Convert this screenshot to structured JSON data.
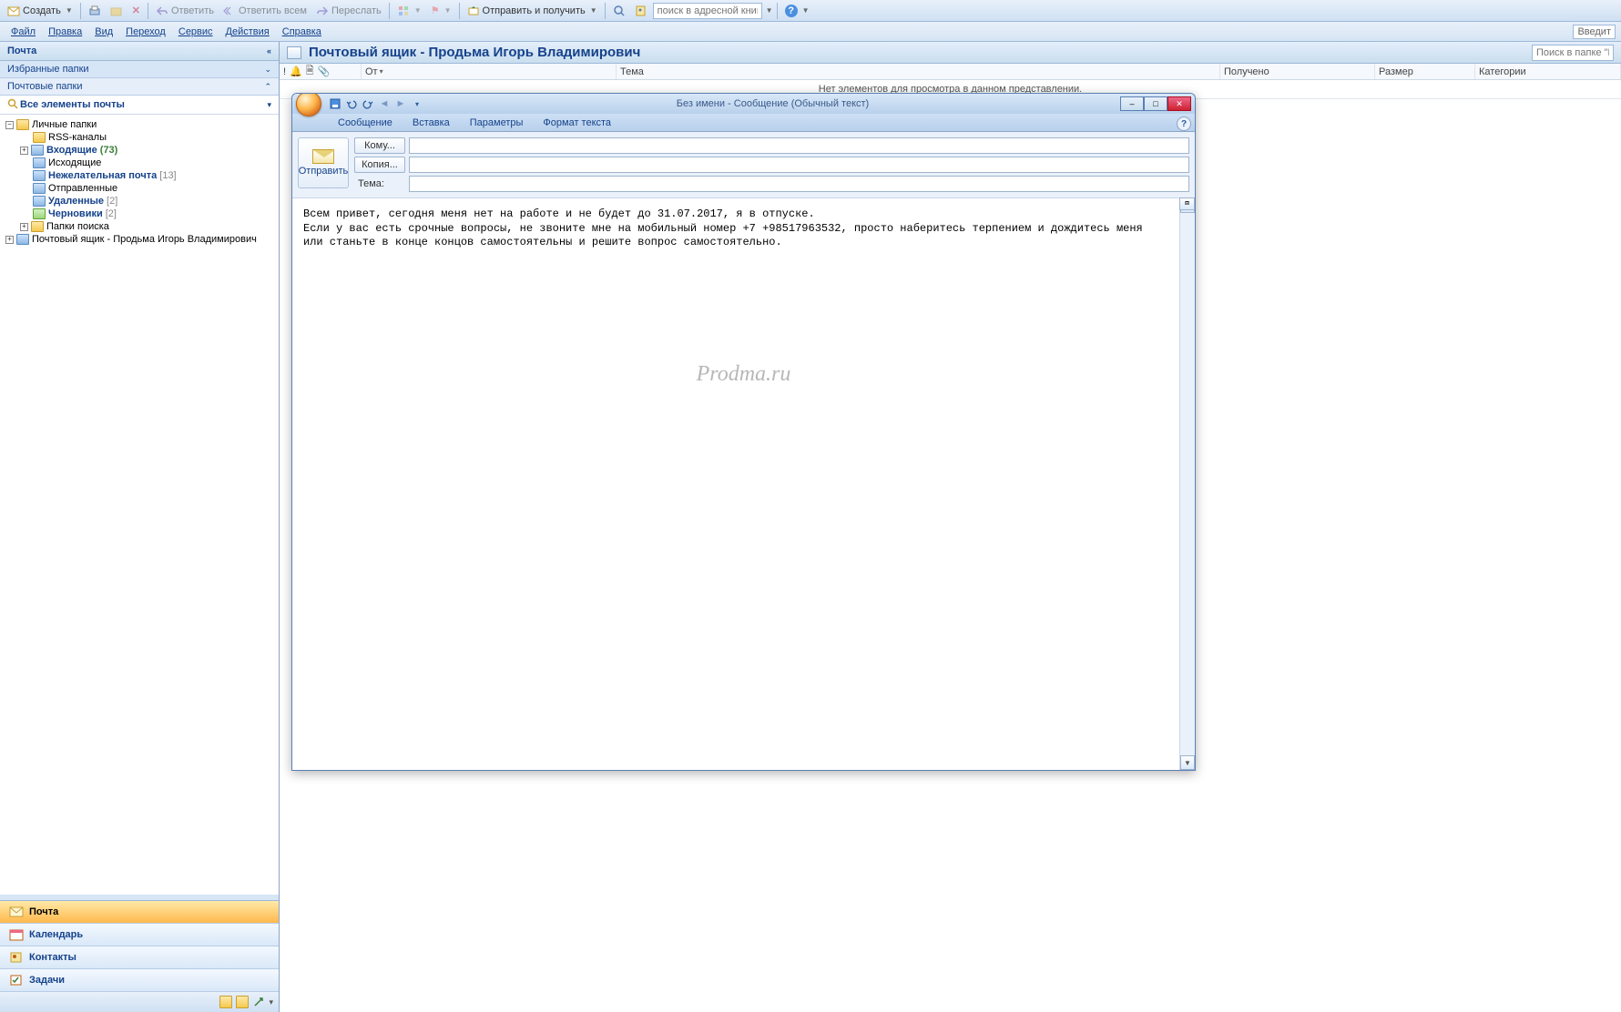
{
  "toolbar": {
    "create": "Создать",
    "reply": "Ответить",
    "reply_all": "Ответить всем",
    "forward": "Переслать",
    "send_receive": "Отправить и получить",
    "addrbook_placeholder": "поиск в адресной книге"
  },
  "menu": {
    "file": "Файл",
    "edit": "Правка",
    "view": "Вид",
    "go": "Переход",
    "tools": "Сервис",
    "actions": "Действия",
    "help": "Справка",
    "type_hint": "Введит"
  },
  "sidebar": {
    "mail_header": "Почта",
    "fav_folders": "Избранные папки",
    "mail_folders": "Почтовые папки",
    "all_items": "Все элементы почты",
    "tree": {
      "personal": "Личные папки",
      "rss": "RSS-каналы",
      "inbox": "Входящие",
      "inbox_count": "(73)",
      "outbox": "Исходящие",
      "junk": "Нежелательная почта",
      "junk_count": "[13]",
      "sent": "Отправленные",
      "deleted": "Удаленные",
      "deleted_count": "[2]",
      "drafts": "Черновики",
      "drafts_count": "[2]",
      "search": "Папки поиска",
      "mailbox2": "Почтовый ящик - Продьма Игорь Владимирович"
    },
    "nav": {
      "mail": "Почта",
      "calendar": "Календарь",
      "contacts": "Контакты",
      "tasks": "Задачи"
    }
  },
  "content": {
    "title": "Почтовый ящик - Продьма Игорь Владимирович",
    "search_placeholder": "Поиск в папке \"Почто",
    "columns": {
      "from": "От",
      "subject": "Тема",
      "received": "Получено",
      "size": "Размер",
      "categories": "Категории"
    },
    "empty": "Нет элементов для просмотра в данном представлении."
  },
  "compose": {
    "title": "Без имени - Сообщение (Обычный текст)",
    "tabs": {
      "message": "Сообщение",
      "insert": "Вставка",
      "options": "Параметры",
      "format": "Формат текста"
    },
    "send": "Отправить",
    "to": "Кому...",
    "cc": "Копия...",
    "subject": "Тема:",
    "body": "Всем привет, сегодня меня нет на работе и не будет до 31.07.2017, я в отпуске.\nЕсли у вас есть срочные вопросы, не звоните мне на мобильный номер +7 +98517963532, просто наберитесь терпением и дождитесь меня или станьте в конце концов самостоятельны и решите вопрос самостоятельно.",
    "watermark": "Prodma.ru"
  }
}
